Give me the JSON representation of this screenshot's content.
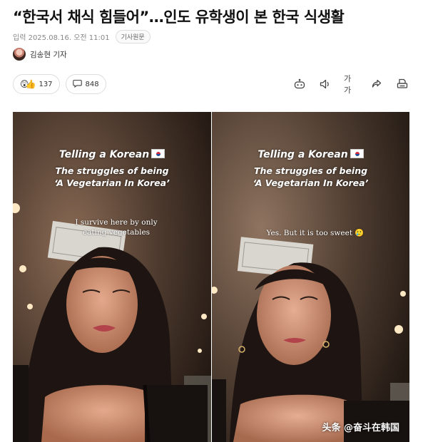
{
  "article": {
    "title": "“한국서 채식 힘들어”…인도 유학생이 본 한국 식생활",
    "published": "입력 2025.08.16. 오전 11:01",
    "original_button": "기사원문",
    "reporter": "김송현 기자"
  },
  "reactions": {
    "like_count": "137",
    "comment_count": "848"
  },
  "toolbar": {
    "icons": [
      "listen-robot-icon",
      "speaker-icon",
      "font-size-icon",
      "share-icon",
      "print-icon"
    ],
    "font_size_label": "가가"
  },
  "video_left": {
    "caption_line1": "Telling a Korean",
    "caption_line2": "The struggles of being",
    "caption_line3": "‘A Vegetarian In Korea’",
    "subtitle_line1": "I survive here by only",
    "subtitle_line2": "eating vegetables"
  },
  "video_right": {
    "caption_line1": "Telling a Korean",
    "caption_line2": "The struggles of being",
    "caption_line3": "‘A Vegetarian In Korea’",
    "subtitle": "Yes. But it is too sweet 🥲"
  },
  "watermark": "头条 @奋斗在韩国"
}
